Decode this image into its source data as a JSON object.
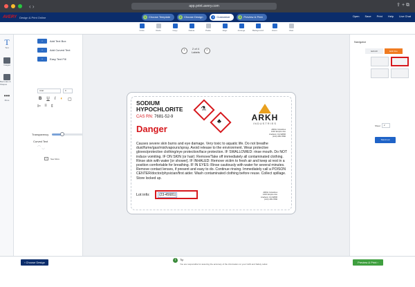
{
  "browser": {
    "url": "app.print.avery.com"
  },
  "app": {
    "brand": "AVERY",
    "crumb": "Design & Print Online",
    "steps": [
      {
        "n": "1",
        "label": "Choose Template"
      },
      {
        "n": "2",
        "label": "Choose Design"
      },
      {
        "n": "3",
        "label": "Customize"
      },
      {
        "n": "4",
        "label": "Preview & Print"
      }
    ],
    "actions": [
      "Open",
      "Save",
      "Print",
      "Help",
      "Live Chat"
    ]
  },
  "toolbar": {
    "tools": [
      "Undo",
      "Redo",
      "Copy",
      "Delete",
      "Paste",
      "Align",
      "Arrange",
      "Background",
      "Zoom",
      "View"
    ]
  },
  "rail": {
    "items": [
      "Text",
      "Images",
      "Barcodes & Shapes",
      "More"
    ]
  },
  "left_panel": {
    "buttons": [
      {
        "icon": "add",
        "label": "Add Text Box"
      },
      {
        "icon": "add",
        "label": "Add Curved Text"
      },
      {
        "icon": "add",
        "label": "Easy Text Fill"
      }
    ],
    "font": "Arial",
    "size": "9",
    "transparency_label": "Transparency",
    "transparency_value": 0.25,
    "curved_label": "Curved Text",
    "see_more": "See More"
  },
  "canvas": {
    "page_indicator": "2 of 4",
    "page_sub": "Labels"
  },
  "label": {
    "product_line1": "SODIUM",
    "product_line2": "HYPOCHLORITE",
    "cas_label": "CAS RN:",
    "cas_value": "7681-52-9",
    "signal_word": "Danger",
    "brand_name": "ARKH",
    "brand_sub": "INDUSTRIES",
    "address_top": "ARKH Industries\n1416 Empire Ave\nAnaheim CA 92806\n(123) 465-7890",
    "hazard_text": "Causes severe skin burns and eye damage. Very toxic to aquatic life. Do not breathe dust/fume/gas/mist/vapours/spray. Avoid release to the environment. Wear protective gloves/protective clothing/eye protection/face protection. IF SWALLOWED: rinse mouth. Do NOT induce vomiting. IF ON SKIN (or hair): Remove/Take off immediately all contaminated clothing. Rinse skin with water [or shower]. IF INHALED: Remove victim to fresh air and keep at rest in a position comfortable for breathing. IF IN EYES: Rinse cautiously with water for several minutes. Remove contact lenses, if present and easy to do. Continue rinsing. Immediately call a POISON CENTER/doctor/physician/first aider. Wash contaminated clothing before reuse. Collect spillage. Store locked up.",
    "lot_label": "Lot info:",
    "lot_value": "(23-45681)",
    "address_bottom": "ARKH Industries\n1416 Empire Ave\nAnaheim CA 92806\n(123) 465-7890"
  },
  "right_panel": {
    "title": "Navigator",
    "tabs": [
      "Edit All",
      "Edit One"
    ],
    "zoom_label": "Sheet",
    "zoom_value": "2",
    "action_button": "Stand out"
  },
  "bottom": {
    "back_button": "Choose Design",
    "tip_title": "Tip",
    "tip_message": "You are responsible for assuring the accuracy of the information on your GHS and Safety Label.",
    "next_button": "Preview & Print"
  },
  "colors": {
    "brand_navy": "#0b2d6b",
    "danger_red": "#d6171c",
    "accent_blue": "#1f63c7",
    "tab_orange": "#f07b21",
    "preview_green": "#3f9f3f"
  }
}
